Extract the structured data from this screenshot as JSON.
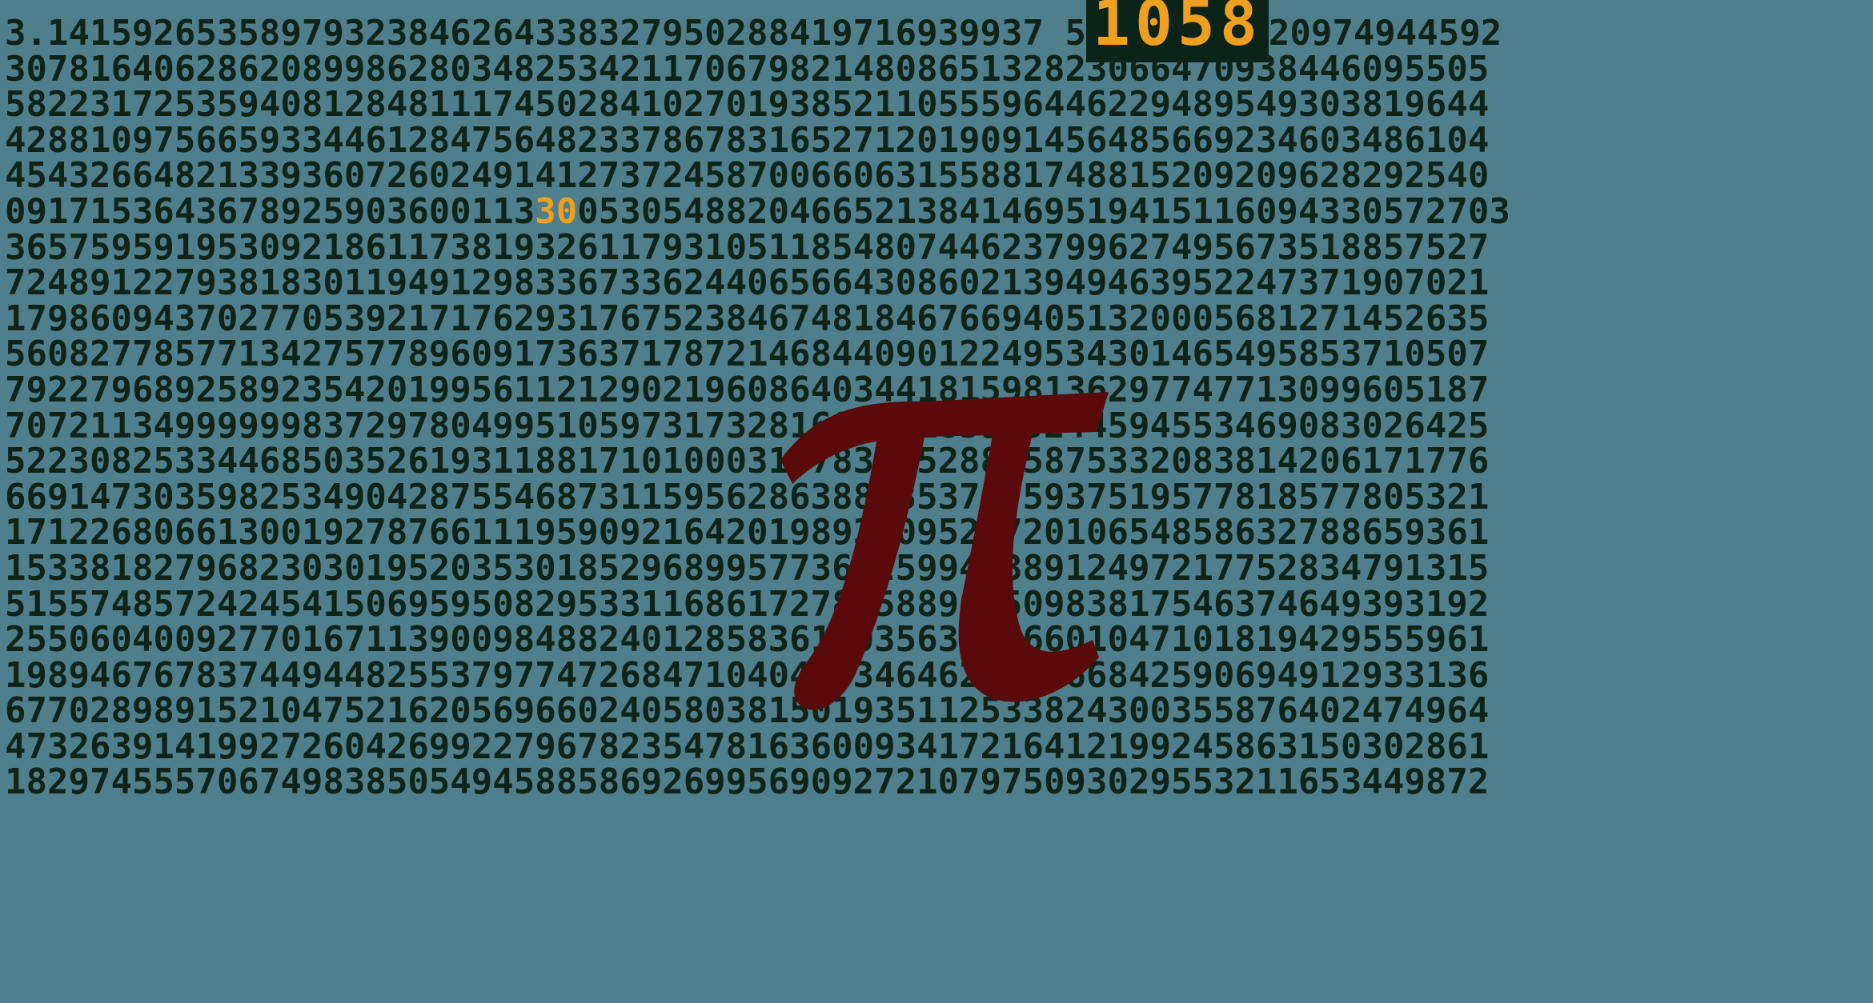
{
  "counter": {
    "value": "1058"
  },
  "highlight_small": "30",
  "accent_color": "#f0a020",
  "digit_color": "#0f2416",
  "background_color": "#4f7e8c",
  "pi_color": "#5a0a0a",
  "icons": {
    "center": "pi-symbol-icon"
  },
  "rows": [
    {
      "before": "3.14159265358979323846264338327950288419716939937 5",
      "after": "20974944592"
    },
    {
      "text": "3078164062862089986280348253421170679821480865132823066470938446095505"
    },
    {
      "text": "5822317253594081284811174502841027019385211055596446229489549303819644"
    },
    {
      "text": "4288109756659334461284756482337867831652712019091456485669234603486104"
    },
    {
      "text": "4543266482133936072602491412737245870066063155881748815209209628292540"
    },
    {
      "before": "0917153643678925903600113",
      "mid": "05305488204665213841469519415116094330572703",
      "after": ""
    },
    {
      "text": "3657595919530921861173819326117931051185480744623799627495673518857527"
    },
    {
      "text": "7248912279381830119491298336733624406566430860213949463952247371907021"
    },
    {
      "text": "1798609437027705392171762931767523846748184676694051320005681271452635"
    },
    {
      "text": "5608277857713427577896091736371787214684409012249534301465495853710507"
    },
    {
      "text": "7922796892589235420199561121290219608640344181598136297747713099605187"
    },
    {
      "text": "7072113499999983729780499510597317328160963185950244594553469083026425"
    },
    {
      "text": "5223082533446850352619311881710100031378387528865875332083814206171776"
    },
    {
      "text": "6691473035982534904287554687311595628638823537875937519577818577805321"
    },
    {
      "text": "1712268066130019278766111959092164201989380952572010654858632788659361"
    },
    {
      "text": "1533818279682303019520353018529689957736225994138912497217752834791315"
    },
    {
      "text": "5155748572424541506959508295331168617278558890750983817546374649393192"
    },
    {
      "text": "2550604009277016711390098488240128583616035637076601047101819429555961"
    },
    {
      "text": "1989467678374494482553797747268471040475346462080466842590694912933136"
    },
    {
      "text": "6770289891521047521620569660240580381501935112533824300355876402474964"
    },
    {
      "text": "4732639141992726042699227967823547816360093417216412199245863150302861"
    },
    {
      "text": "1829745557067498385054945885869269956909272107975093029553211653449872"
    }
  ]
}
